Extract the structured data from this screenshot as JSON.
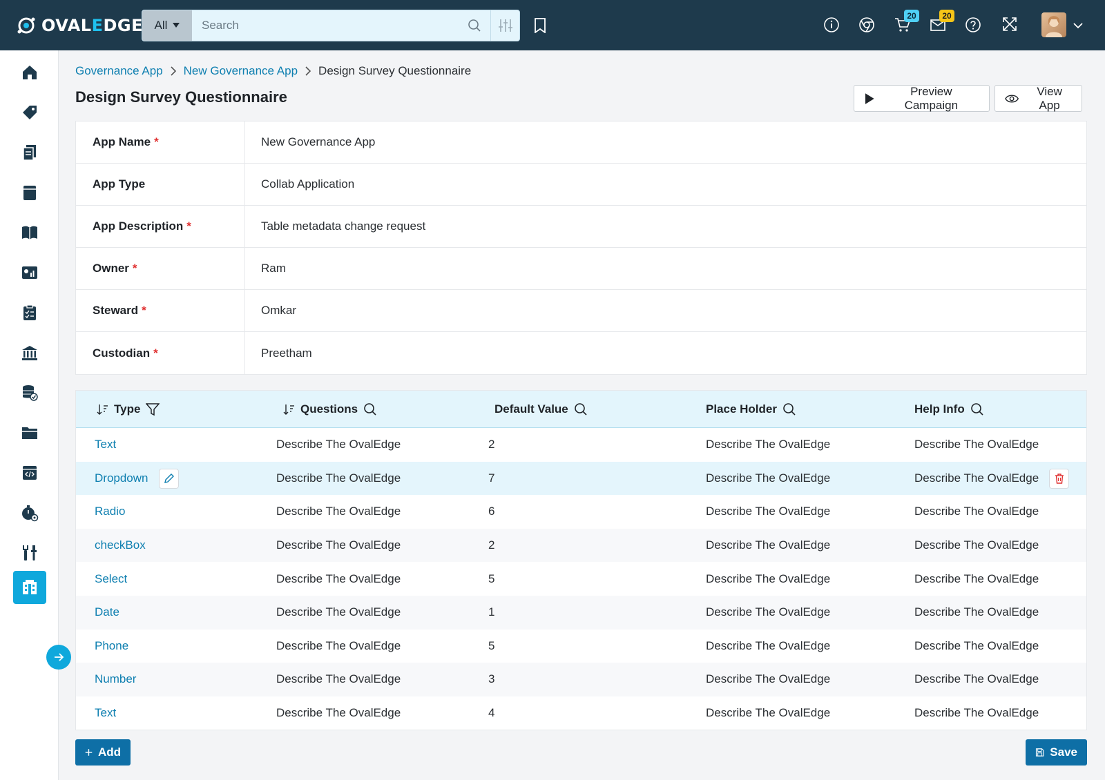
{
  "brand": {
    "name_left": "OVAL",
    "name_e": "E",
    "name_right": "DGE"
  },
  "search": {
    "category": "All",
    "placeholder": "Search"
  },
  "notifications": {
    "cart_count": "20",
    "mail_count": "20"
  },
  "colors": {
    "topbar": "#1e3a4c",
    "accent": "#0fa8dc",
    "link": "#0e7fb0",
    "primary": "#0e6fa6",
    "required": "#e03131"
  },
  "breadcrumb": {
    "items": [
      "Governance App",
      "New Governance App"
    ],
    "current": "Design Survey Questionnaire"
  },
  "page": {
    "title": "Design Survey Questionnaire"
  },
  "actions": {
    "preview_label": "Preview Campaign",
    "view_app_label": "View App",
    "add_label": "Add",
    "save_label": "Save"
  },
  "details": [
    {
      "label": "App Name",
      "required": true,
      "value": "New Governance App"
    },
    {
      "label": "App Type",
      "required": false,
      "value": "Collab Application"
    },
    {
      "label": "App Description",
      "required": true,
      "value": "Table metadata change request"
    },
    {
      "label": "Owner",
      "required": true,
      "value": "Ram"
    },
    {
      "label": "Steward",
      "required": true,
      "value": "Omkar"
    },
    {
      "label": "Custodian",
      "required": true,
      "value": "Preetham"
    }
  ],
  "table": {
    "columns": [
      "Type",
      "Questions",
      "Default Value",
      "Place Holder",
      "Help Info"
    ],
    "rows": [
      {
        "type": "Text",
        "question": "Describe The OvalEdge",
        "default": "2",
        "placeholder": "Describe The OvalEdge",
        "help": "Describe The OvalEdge"
      },
      {
        "type": "Dropdown",
        "question": "Describe The OvalEdge",
        "default": "7",
        "placeholder": "Describe The OvalEdge",
        "help": "Describe The OvalEdge"
      },
      {
        "type": "Radio",
        "question": "Describe The OvalEdge",
        "default": "6",
        "placeholder": "Describe The OvalEdge",
        "help": "Describe The OvalEdge"
      },
      {
        "type": "checkBox",
        "question": "Describe The OvalEdge",
        "default": "2",
        "placeholder": "Describe The OvalEdge",
        "help": "Describe The OvalEdge"
      },
      {
        "type": "Select",
        "question": "Describe The OvalEdge",
        "default": "5",
        "placeholder": "Describe The OvalEdge",
        "help": "Describe The OvalEdge"
      },
      {
        "type": "Date",
        "question": "Describe The OvalEdge",
        "default": "1",
        "placeholder": "Describe The OvalEdge",
        "help": "Describe The OvalEdge"
      },
      {
        "type": "Phone",
        "question": "Describe The OvalEdge",
        "default": "5",
        "placeholder": "Describe The OvalEdge",
        "help": "Describe The OvalEdge"
      },
      {
        "type": "Number",
        "question": "Describe The OvalEdge",
        "default": "3",
        "placeholder": "Describe The OvalEdge",
        "help": "Describe The OvalEdge"
      },
      {
        "type": "Text",
        "question": "Describe The OvalEdge",
        "default": "4",
        "placeholder": "Describe The OvalEdge",
        "help": "Describe The OvalEdge"
      }
    ]
  },
  "sidebar": {
    "items": [
      "home-icon",
      "tag-icon",
      "documents-icon",
      "book-icon",
      "glossary-icon",
      "reports-icon",
      "checklist-icon",
      "bank-icon",
      "database-check-icon",
      "folder-icon",
      "code-icon",
      "timer-settings-icon",
      "tools-icon",
      "governance-app-icon"
    ]
  }
}
